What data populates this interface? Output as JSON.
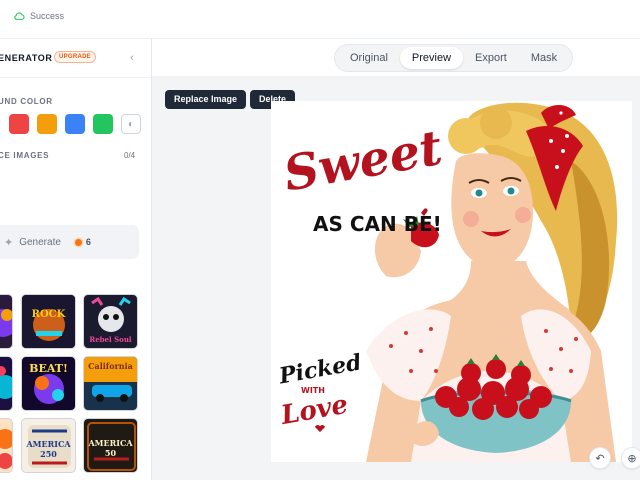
{
  "topbar": {
    "status_text": "Success",
    "status_icon": "cloud-check-icon"
  },
  "sidebar": {
    "title": "ENERATOR",
    "upgrade_badge": "UPGRADE",
    "background_label": "UND COLOR",
    "swatches": [
      {
        "name": "red",
        "color": "#ef4444"
      },
      {
        "name": "orange",
        "color": "#f59e0b"
      },
      {
        "name": "blue",
        "color": "#3b82f6"
      },
      {
        "name": "green",
        "color": "#22c55e"
      }
    ],
    "reference_label": "CE IMAGES",
    "reference_count": "0/4",
    "generate_label": "Generate",
    "generate_credits": "6",
    "thumbnails": [
      {
        "caption": ""
      },
      {
        "caption": "ROCK"
      },
      {
        "caption": "Rebel Soul"
      },
      {
        "caption": ""
      },
      {
        "caption": "BEAT!"
      },
      {
        "caption": "California"
      },
      {
        "caption": ""
      },
      {
        "caption": "AMERICA 250"
      },
      {
        "caption": "AMERICA 50"
      }
    ]
  },
  "main": {
    "tabs": [
      {
        "label": "Original",
        "active": false
      },
      {
        "label": "Preview",
        "active": true
      },
      {
        "label": "Export",
        "active": false
      },
      {
        "label": "Mask",
        "active": false
      }
    ],
    "replace_button": "Replace Image",
    "delete_button": "Delete",
    "artwork": {
      "headline": "Sweet",
      "subhead": "AS CAN BE!",
      "picked": "Picked",
      "with": "WITH",
      "love": "Love"
    },
    "undo_icon": "undo-icon",
    "zoom_icon": "zoom-icon"
  }
}
